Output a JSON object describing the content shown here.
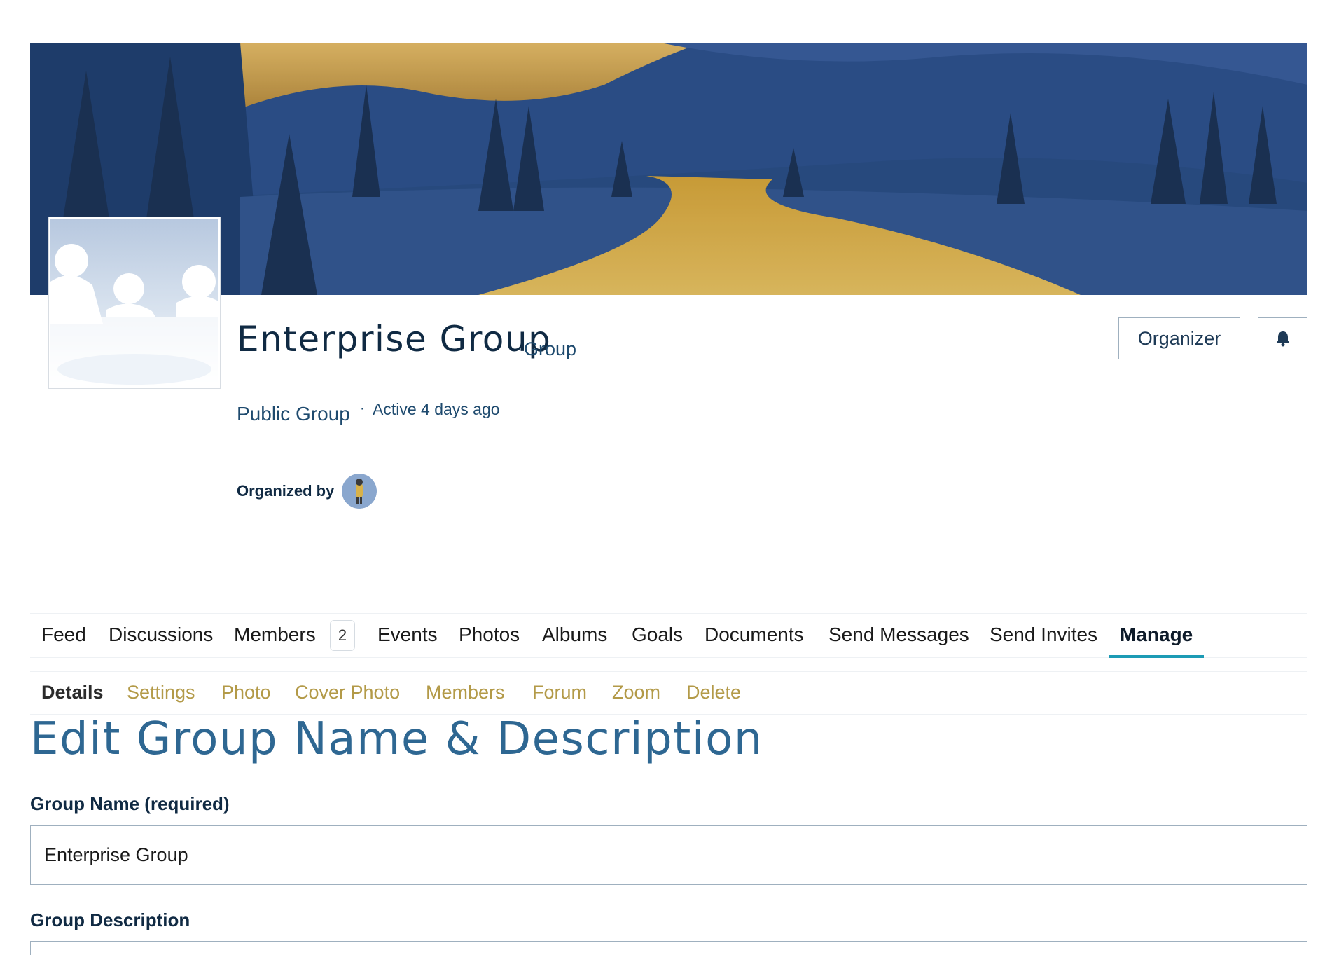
{
  "group": {
    "name": "Enterprise Group",
    "type_label": "Group",
    "privacy": "Public Group",
    "separator": "·",
    "activity": "Active 4 days ago",
    "organized_by_label": "Organized by"
  },
  "header_actions": {
    "organizer_label": "Organizer"
  },
  "primary_nav": {
    "items": [
      {
        "label": "Feed"
      },
      {
        "label": "Discussions"
      },
      {
        "label": "Members",
        "count": "2"
      },
      {
        "label": "Events"
      },
      {
        "label": "Photos"
      },
      {
        "label": "Albums"
      },
      {
        "label": "Goals"
      },
      {
        "label": "Documents"
      },
      {
        "label": "Send Messages"
      },
      {
        "label": "Send Invites"
      },
      {
        "label": "Manage",
        "active": true
      }
    ]
  },
  "manage_nav": {
    "items": [
      {
        "label": "Details",
        "current": true
      },
      {
        "label": "Settings"
      },
      {
        "label": "Photo"
      },
      {
        "label": "Cover Photo"
      },
      {
        "label": "Members"
      },
      {
        "label": "Forum"
      },
      {
        "label": "Zoom"
      },
      {
        "label": "Delete"
      }
    ]
  },
  "form": {
    "heading": "Edit Group Name & Description",
    "name_label": "Group Name (required)",
    "name_value": "Enterprise Group",
    "description_label": "Group Description"
  },
  "colors": {
    "accent_underline": "#1d9bb5",
    "sub_nav_link": "#b39a48",
    "heading_blue": "#2e6792",
    "text_navy": "#102a43"
  }
}
